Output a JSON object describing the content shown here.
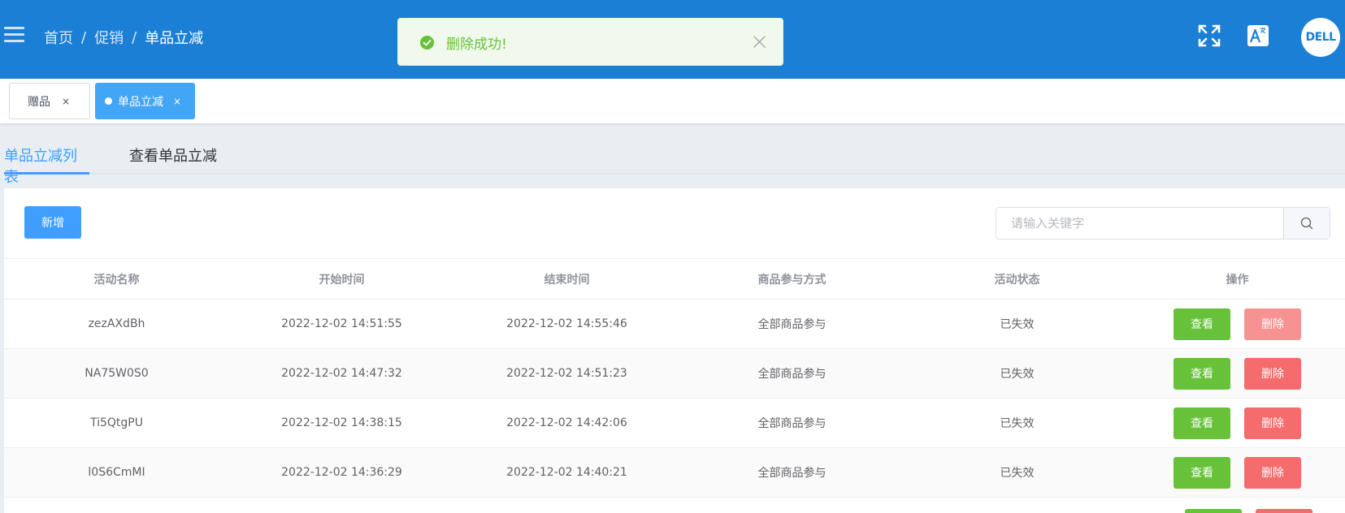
{
  "header": {
    "breadcrumb": [
      "首页",
      "促销",
      "单品立减"
    ],
    "separator": "/",
    "avatar_text": "DELL",
    "icons": [
      "menu-icon",
      "fullscreen-icon",
      "translate-icon"
    ],
    "brand_color": "#1c7fd6"
  },
  "toast": {
    "message": "删除成功!",
    "status": "success",
    "color": "#67c23a"
  },
  "tags": [
    {
      "label": "赠品",
      "close": "×",
      "active": false
    },
    {
      "label": "单品立减",
      "close": "×",
      "active": true
    }
  ],
  "tabs": [
    {
      "label": "单品立减列表",
      "active": true
    },
    {
      "label": "查看单品立减",
      "active": false
    }
  ],
  "toolbar": {
    "add_label": "新增",
    "search_placeholder": "请输入关键字"
  },
  "table": {
    "columns": [
      "活动名称",
      "开始时间",
      "结束时间",
      "商品参与方式",
      "活动状态",
      "操作"
    ],
    "rows": [
      {
        "name": "zezAXdBh",
        "start": "2022-12-02 14:51:55",
        "end": "2022-12-02 14:55:46",
        "mode": "全部商品参与",
        "status": "已失效"
      },
      {
        "name": "NA75W0S0",
        "start": "2022-12-02 14:47:32",
        "end": "2022-12-02 14:51:23",
        "mode": "全部商品参与",
        "status": "已失效"
      },
      {
        "name": "Ti5QtgPU",
        "start": "2022-12-02 14:38:15",
        "end": "2022-12-02 14:42:06",
        "mode": "全部商品参与",
        "status": "已失效"
      },
      {
        "name": "l0S6CmMI",
        "start": "2022-12-02 14:36:29",
        "end": "2022-12-02 14:40:21",
        "mode": "全部商品参与",
        "status": "已失效"
      }
    ],
    "view_label": "查看",
    "delete_label": "删除"
  },
  "colors": {
    "primary": "#409eff",
    "success": "#67c23a",
    "danger": "#f56c6c"
  }
}
